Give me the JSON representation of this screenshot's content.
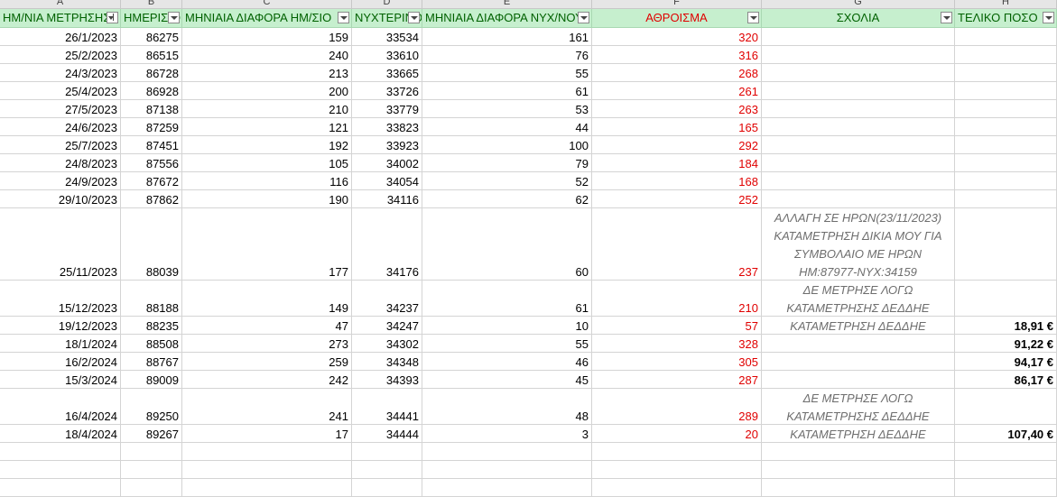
{
  "columns": {
    "letters": [
      "A",
      "B",
      "C",
      "D",
      "E",
      "F",
      "G",
      "H"
    ]
  },
  "header": [
    {
      "label": "ΗΜ/ΝΙΑ ΜΕΤΡΗΣΗΣ",
      "filter": "active"
    },
    {
      "label": "ΗΜΕΡΙΣΙΟ",
      "filter": "normal"
    },
    {
      "label": "ΜΗΝΙΑΙΑ ΔΙΑΦΟΡΑ ΗΜ/ΣΙΟ",
      "filter": "normal"
    },
    {
      "label": "ΝΥΧΤΕΡΙΝΟ",
      "filter": "normal"
    },
    {
      "label": "ΜΗΝΙΑΙΑ ΔΙΑΦΟΡΑ ΝΥΧ/ΝΟΥ",
      "filter": "normal"
    },
    {
      "label": "ΑΘΡΟΙΣΜΑ",
      "filter": "normal"
    },
    {
      "label": "ΣΧΟΛΙΑ",
      "filter": "normal"
    },
    {
      "label": "ΤΕΛΙΚΟ ΠΟΣΟ",
      "filter": "normal"
    }
  ],
  "rows": [
    {
      "date": "26/1/2023",
      "day": "86275",
      "day_diff": "159",
      "night": "33534",
      "night_diff": "161",
      "sum": "320",
      "comment": [],
      "final": ""
    },
    {
      "date": "25/2/2023",
      "day": "86515",
      "day_diff": "240",
      "night": "33610",
      "night_diff": "76",
      "sum": "316",
      "comment": [],
      "final": ""
    },
    {
      "date": "24/3/2023",
      "day": "86728",
      "day_diff": "213",
      "night": "33665",
      "night_diff": "55",
      "sum": "268",
      "comment": [],
      "final": ""
    },
    {
      "date": "25/4/2023",
      "day": "86928",
      "day_diff": "200",
      "night": "33726",
      "night_diff": "61",
      "sum": "261",
      "comment": [],
      "final": ""
    },
    {
      "date": "27/5/2023",
      "day": "87138",
      "day_diff": "210",
      "night": "33779",
      "night_diff": "53",
      "sum": "263",
      "comment": [],
      "final": ""
    },
    {
      "date": "24/6/2023",
      "day": "87259",
      "day_diff": "121",
      "night": "33823",
      "night_diff": "44",
      "sum": "165",
      "comment": [],
      "final": ""
    },
    {
      "date": "25/7/2023",
      "day": "87451",
      "day_diff": "192",
      "night": "33923",
      "night_diff": "100",
      "sum": "292",
      "comment": [],
      "final": ""
    },
    {
      "date": "24/8/2023",
      "day": "87556",
      "day_diff": "105",
      "night": "34002",
      "night_diff": "79",
      "sum": "184",
      "comment": [],
      "final": ""
    },
    {
      "date": "24/9/2023",
      "day": "87672",
      "day_diff": "116",
      "night": "34054",
      "night_diff": "52",
      "sum": "168",
      "comment": [],
      "final": ""
    },
    {
      "date": "29/10/2023",
      "day": "87862",
      "day_diff": "190",
      "night": "34116",
      "night_diff": "62",
      "sum": "252",
      "comment": [],
      "final": ""
    },
    {
      "date": "25/11/2023",
      "day": "88039",
      "day_diff": "177",
      "night": "34176",
      "night_diff": "60",
      "sum": "237",
      "comment": [
        "ΑΛΛΑΓΗ ΣΕ ΗΡΩΝ(23/11/2023)",
        "ΚΑΤΑΜΕΤΡΗΣΗ ΔΙΚΙΑ ΜΟΥ ΓΙΑ",
        "ΣΥΜΒΟΛΑΙΟ ΜΕ ΗΡΩΝ",
        "ΗΜ:87977-ΝΥΧ:34159"
      ],
      "final": ""
    },
    {
      "date": "15/12/2023",
      "day": "88188",
      "day_diff": "149",
      "night": "34237",
      "night_diff": "61",
      "sum": "210",
      "comment": [
        "ΔΕ ΜΕΤΡΗΣΕ ΛΟΓΩ",
        "ΚΑΤΑΜΕΤΡΗΣΗΣ ΔΕΔΔΗΕ"
      ],
      "final": ""
    },
    {
      "date": "19/12/2023",
      "day": "88235",
      "day_diff": "47",
      "night": "34247",
      "night_diff": "10",
      "sum": "57",
      "comment": [
        "ΚΑΤΑΜΕΤΡΗΣΗ ΔΕΔΔΗΕ"
      ],
      "final": "18,91 €"
    },
    {
      "date": "18/1/2024",
      "day": "88508",
      "day_diff": "273",
      "night": "34302",
      "night_diff": "55",
      "sum": "328",
      "comment": [],
      "final": "91,22 €"
    },
    {
      "date": "16/2/2024",
      "day": "88767",
      "day_diff": "259",
      "night": "34348",
      "night_diff": "46",
      "sum": "305",
      "comment": [],
      "final": "94,17 €"
    },
    {
      "date": "15/3/2024",
      "day": "89009",
      "day_diff": "242",
      "night": "34393",
      "night_diff": "45",
      "sum": "287",
      "comment": [],
      "final": "86,17 €"
    },
    {
      "date": "16/4/2024",
      "day": "89250",
      "day_diff": "241",
      "night": "34441",
      "night_diff": "48",
      "sum": "289",
      "comment": [
        "ΔΕ ΜΕΤΡΗΣΕ ΛΟΓΩ",
        "ΚΑΤΑΜΕΤΡΗΣΗΣ ΔΕΔΔΗΕ"
      ],
      "final": ""
    },
    {
      "date": "18/4/2024",
      "day": "89267",
      "day_diff": "17",
      "night": "34444",
      "night_diff": "3",
      "sum": "20",
      "comment": [
        "ΚΑΤΑΜΕΤΡΗΣΗ ΔΕΔΔΗΕ"
      ],
      "final": "107,40 €"
    }
  ],
  "colors": {
    "header_bg": "#c6efce",
    "header_text": "#006100",
    "sum_color": "#e00000",
    "comment_color": "#6e6e6e"
  }
}
